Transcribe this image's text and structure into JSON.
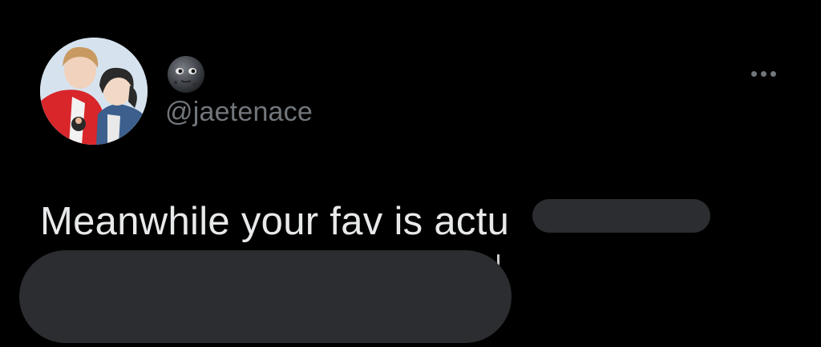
{
  "tweet": {
    "author": {
      "display_name_emoji": "🌚",
      "display_name_icon": "new-moon-face-icon",
      "handle": "@jaetenace"
    },
    "more_icon": "more-options-icon",
    "text": "Meanwhile your fav is actu",
    "redacted_segments": 2
  },
  "colors": {
    "background": "#000000",
    "text_primary": "#e7e9ea",
    "text_secondary": "#71767b",
    "redaction": "#2b2d30"
  }
}
